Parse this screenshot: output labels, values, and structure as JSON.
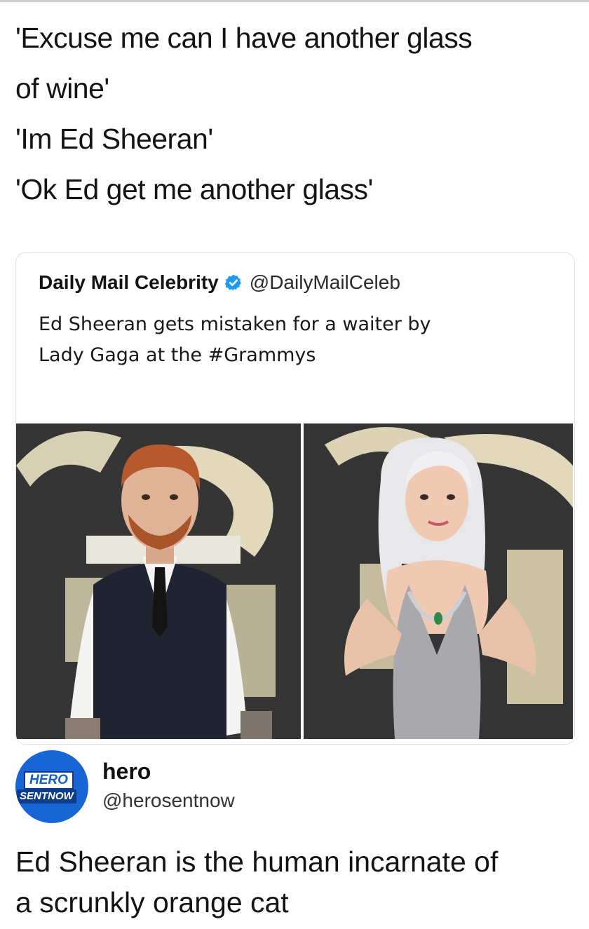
{
  "caption": {
    "lines": [
      "'Excuse me can I have another glass",
      "of wine'",
      "'Im Ed Sheeran'",
      "'Ok Ed get me another glass'"
    ]
  },
  "quoted_tweet": {
    "name": "Daily Mail Celebrity",
    "verified_icon": "verified-badge-icon",
    "handle": "@DailyMailCeleb",
    "text_lines": [
      "Ed Sheeran gets mistaken for a waiter by",
      "Lady Gaga at the #Grammys"
    ],
    "photos": [
      "ed-sheeran-photo",
      "lady-gaga-photo"
    ]
  },
  "tweet": {
    "avatar_logo_line1": "HERO",
    "avatar_logo_line2": "SENTNOW",
    "name": "hero",
    "handle": "@herosentnow",
    "text_lines": [
      "Ed Sheeran is the human incarnate of",
      "a scrunkly orange cat"
    ]
  },
  "colors": {
    "verified_blue": "#1d9bf0",
    "avatar_blue": "#1866d6",
    "text": "#141414"
  }
}
